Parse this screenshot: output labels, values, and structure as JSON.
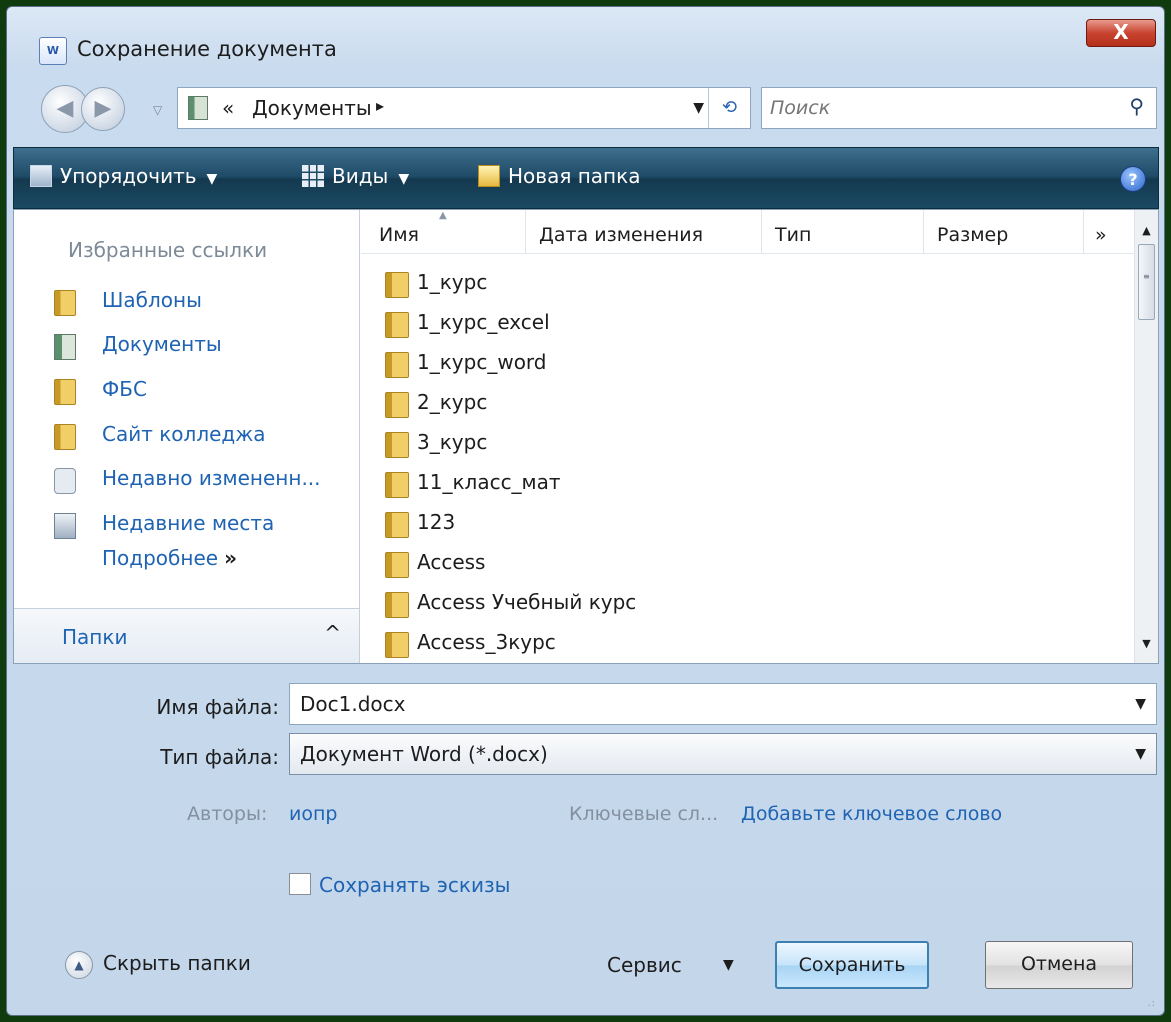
{
  "window": {
    "title": "Сохранение документа",
    "app_icon_text": "W",
    "close_symbol": "X"
  },
  "address": {
    "prefix": "«",
    "crumb": "Документы",
    "separator": "▸",
    "dropdown": "▼",
    "refresh_symbol": "⟲"
  },
  "search": {
    "placeholder": "Поиск",
    "icon": "magnifier-icon"
  },
  "toolbar": {
    "organize_label": "Упорядочить",
    "views_label": "Виды",
    "new_folder_label": "Новая папка",
    "caret": "▼",
    "help_symbol": "?"
  },
  "sidebar": {
    "heading": "Избранные ссылки",
    "items": [
      {
        "label": "Шаблоны",
        "icon": "folder-icon"
      },
      {
        "label": "Документы",
        "icon": "documents-icon"
      },
      {
        "label": "ФБС",
        "icon": "folder-icon"
      },
      {
        "label": "Сайт колледжа",
        "icon": "folder-icon"
      },
      {
        "label": "Недавно измененн...",
        "icon": "recent-icon"
      },
      {
        "label": "Недавние места",
        "icon": "places-icon"
      }
    ],
    "more_label": "Подробнее",
    "more_chevron": "»",
    "folders_label": "Папки",
    "folders_caret": "^"
  },
  "file_list": {
    "columns": [
      "Имя",
      "Дата изменения",
      "Тип",
      "Размер"
    ],
    "more_columns": "»",
    "items": [
      "1_курс",
      "1_курс_excel",
      "1_курс_word",
      "2_курс",
      "3_курс",
      "11_класс_мат",
      "123",
      "Access",
      "Access Учебный курс",
      "Access_3курс"
    ]
  },
  "form": {
    "filename_label": "Имя файла:",
    "filename_value": "Doc1.docx",
    "filetype_label": "Тип файла:",
    "filetype_value": "Документ Word (*.docx)",
    "authors_label": "Авторы:",
    "authors_value": "иопр",
    "keywords_label": "Ключевые сл...",
    "keywords_value": "Добавьте ключевое слово",
    "thumbnails_label": "Сохранять эскизы",
    "dropdown_caret": "▼"
  },
  "footer": {
    "hide_folders_label": "Скрыть папки",
    "service_label": "Сервис",
    "save_label": "Сохранить",
    "cancel_label": "Отмена"
  }
}
